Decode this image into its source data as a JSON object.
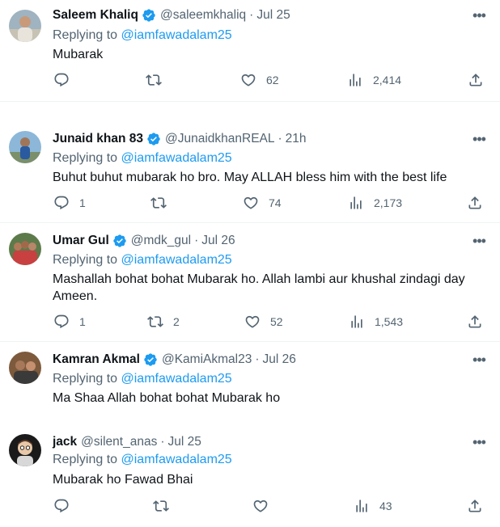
{
  "tweets": [
    {
      "name": "Saleem Khaliq",
      "verified": true,
      "handle": "@saleemkhaliq",
      "time": "Jul 25",
      "replying_label": "Replying to",
      "mention": "@iamfawadalam25",
      "text": "Mubarak",
      "replies": "",
      "retweets": "",
      "likes": "62",
      "views": "2,414"
    },
    {
      "name": "Junaid khan 83",
      "verified": true,
      "handle": "@JunaidkhanREAL",
      "time": "21h",
      "replying_label": "Replying to",
      "mention": "@iamfawadalam25",
      "text": "Buhut buhut mubarak ho bro. May ALLAH bless him with the best life",
      "replies": "1",
      "retweets": "",
      "likes": "74",
      "views": "2,173"
    },
    {
      "name": "Umar Gul",
      "verified": true,
      "handle": "@mdk_gul",
      "time": "Jul 26",
      "replying_label": "Replying to",
      "mention": "@iamfawadalam25",
      "text": "Mashallah bohat bohat Mubarak ho. Allah lambi aur khushal zindagi day Ameen.",
      "replies": "1",
      "retweets": "2",
      "likes": "52",
      "views": "1,543"
    },
    {
      "name": "Kamran Akmal",
      "verified": true,
      "handle": "@KamiAkmal23",
      "time": "Jul 26",
      "replying_label": "Replying to",
      "mention": "@iamfawadalam25",
      "text": "Ma Shaa Allah bohat bohat Mubarak ho"
    },
    {
      "name": "jack",
      "verified": false,
      "handle": "@silent_anas",
      "time": "Jul 25",
      "replying_label": "Replying to",
      "mention": "@iamfawadalam25",
      "text": "Mubarak ho Fawad Bhai",
      "replies": "",
      "retweets": "",
      "likes": "",
      "views": "43"
    }
  ],
  "colors": {
    "accent": "#1d9bf0",
    "muted": "#536471",
    "text": "#0f1419",
    "divider": "#eff3f4"
  },
  "icons": [
    "verified-badge-icon",
    "more-icon",
    "reply-icon",
    "retweet-icon",
    "like-icon",
    "views-icon",
    "share-icon"
  ]
}
